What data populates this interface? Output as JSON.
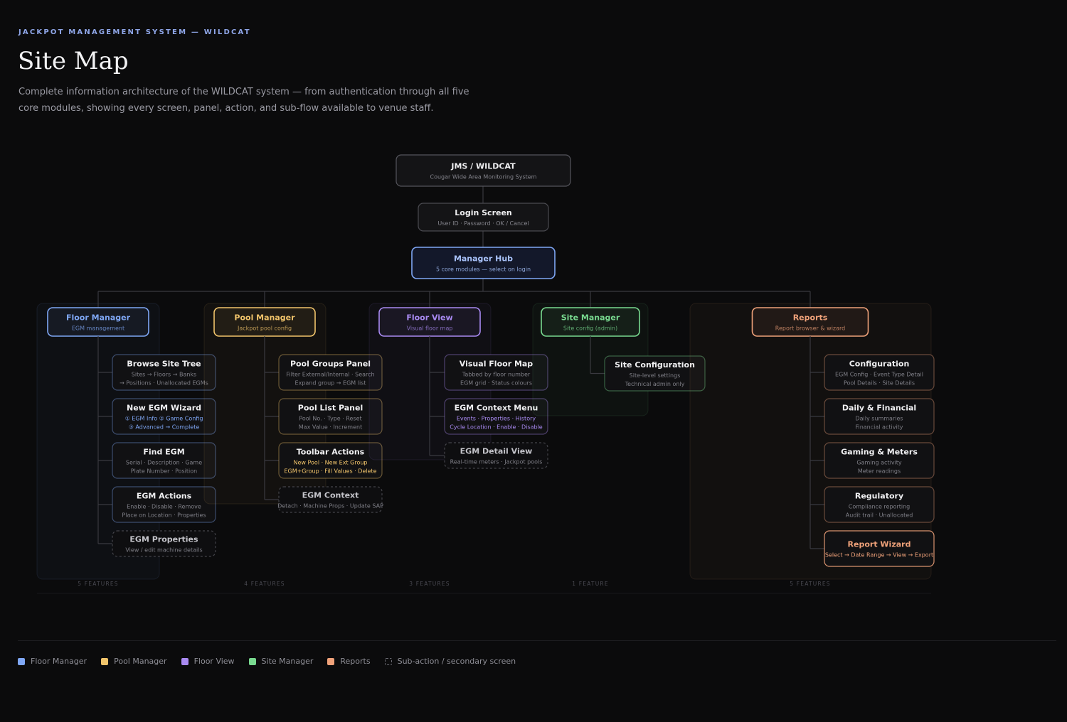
{
  "header": {
    "eyebrow": "JACKPOT MANAGEMENT SYSTEM — WILDCAT",
    "title": "Site Map",
    "description": "Complete information architecture of the WILDCAT system — from authentication through all five core modules, showing every screen, panel, action, and sub-flow available to venue staff."
  },
  "colors": {
    "floor_manager": "#7fa7f5",
    "pool_manager": "#f1c46b",
    "floor_view": "#a98af2",
    "site_manager": "#78d98f",
    "reports": "#f0a27a",
    "neutral": "#7a7a82"
  },
  "root": {
    "title": "JMS / WILDCAT",
    "sub": "Cougar Wide Area Monitoring System"
  },
  "login": {
    "title": "Login Screen",
    "sub": "User ID · Password · OK / Cancel"
  },
  "hub": {
    "title": "Manager Hub",
    "sub": "5 core modules — select on login"
  },
  "modules": [
    {
      "key": "floor_manager",
      "title": "Floor Manager",
      "sub": "EGM management",
      "footer": "5 FEATURES",
      "children": [
        {
          "title": "Browse Site Tree",
          "lines": [
            "Sites → Floors → Banks",
            "→ Positions · Unallocated EGMs"
          ],
          "accent": false,
          "dashed": false
        },
        {
          "title": "New EGM Wizard",
          "lines": [
            "① EGM Info ② Game Config",
            "③ Advanced → Complete"
          ],
          "accent": true,
          "dashed": false
        },
        {
          "title": "Find EGM",
          "lines": [
            "Serial · Description · Game",
            "Plate Number · Position"
          ],
          "accent": false,
          "dashed": false
        },
        {
          "title": "EGM Actions",
          "lines": [
            "Enable · Disable · Remove",
            "Place on Location · Properties"
          ],
          "accent": false,
          "dashed": false
        },
        {
          "title": "EGM Properties",
          "lines": [
            "View / edit machine details"
          ],
          "accent": false,
          "dashed": true
        }
      ]
    },
    {
      "key": "pool_manager",
      "title": "Pool Manager",
      "sub": "Jackpot pool config",
      "footer": "4 FEATURES",
      "children": [
        {
          "title": "Pool Groups Panel",
          "lines": [
            "Filter External/Internal · Search",
            "Expand group → EGM list"
          ],
          "accent": false,
          "dashed": false
        },
        {
          "title": "Pool List Panel",
          "lines": [
            "Pool No. · Type · Reset",
            "Max Value · Increment"
          ],
          "accent": false,
          "dashed": false
        },
        {
          "title": "Toolbar Actions",
          "lines": [
            "New Pool · New Ext Group",
            "EGM+Group · Fill Values · Delete"
          ],
          "accent": true,
          "dashed": false
        },
        {
          "title": "EGM Context",
          "lines": [
            "Detach · Machine Props · Update SAP"
          ],
          "accent": false,
          "dashed": true
        }
      ]
    },
    {
      "key": "floor_view",
      "title": "Floor View",
      "sub": "Visual floor map",
      "footer": "3 FEATURES",
      "children": [
        {
          "title": "Visual Floor Map",
          "lines": [
            "Tabbed by floor number",
            "EGM grid · Status colours"
          ],
          "accent": false,
          "dashed": false
        },
        {
          "title": "EGM Context Menu",
          "lines": [
            "Events · Properties · History",
            "Cycle Location · Enable · Disable"
          ],
          "accent": true,
          "dashed": false
        },
        {
          "title": "EGM Detail View",
          "lines": [
            "Real-time meters · Jackpot pools"
          ],
          "accent": false,
          "dashed": true
        }
      ]
    },
    {
      "key": "site_manager",
      "title": "Site Manager",
      "sub": "Site config (admin)",
      "footer": "1 FEATURE",
      "children": [
        {
          "title": "Site Configuration",
          "lines": [
            "Site-level settings",
            "Technical admin only"
          ],
          "accent": false,
          "dashed": false
        }
      ]
    },
    {
      "key": "reports",
      "title": "Reports",
      "sub": "Report browser & wizard",
      "footer": "5 FEATURES",
      "children": [
        {
          "title": "Configuration",
          "lines": [
            "EGM Config · Event Type Detail",
            "Pool Details · Site Details"
          ],
          "accent": false,
          "dashed": false
        },
        {
          "title": "Daily & Financial",
          "lines": [
            "Daily summaries",
            "Financial activity"
          ],
          "accent": false,
          "dashed": false
        },
        {
          "title": "Gaming & Meters",
          "lines": [
            "Gaming activity",
            "Meter readings"
          ],
          "accent": false,
          "dashed": false
        },
        {
          "title": "Regulatory",
          "lines": [
            "Compliance reporting",
            "Audit trail · Unallocated"
          ],
          "accent": false,
          "dashed": false
        },
        {
          "title": "Report Wizard",
          "lines": [
            "Select → Date Range → View → Export"
          ],
          "accent": true,
          "dashed": false,
          "highlight": true
        }
      ]
    }
  ],
  "legend": [
    {
      "label": "Floor Manager",
      "color": "#7fa7f5"
    },
    {
      "label": "Pool Manager",
      "color": "#f1c46b"
    },
    {
      "label": "Floor View",
      "color": "#a98af2"
    },
    {
      "label": "Site Manager",
      "color": "#78d98f"
    },
    {
      "label": "Reports",
      "color": "#f0a27a"
    },
    {
      "label": "Sub-action / secondary screen",
      "color": "",
      "dashed": true
    }
  ]
}
